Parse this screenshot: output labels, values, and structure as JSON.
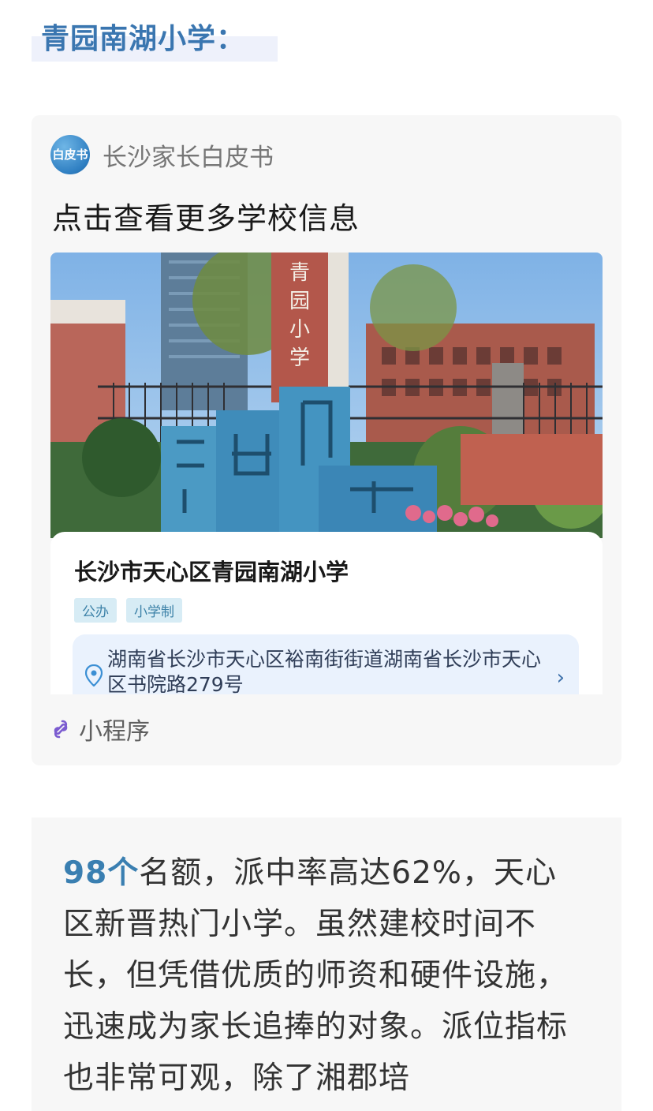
{
  "heading": {
    "title": "青园南湖小学："
  },
  "card": {
    "source_icon_text": "白皮书",
    "source_name": "长沙家长白皮书",
    "headline": "点击查看更多学校信息",
    "school": {
      "name": "长沙市天心区青园南湖小学",
      "tags": [
        "公办",
        "小学制"
      ],
      "address": "湖南省长沙市天心区裕南街街道湖南省长沙市天心区书院路279号"
    },
    "photo_sign_text": "青园小学",
    "mini_program_label": "小程序"
  },
  "article": {
    "highlight": "98个",
    "text": "名额，派中率高达62%，天心区新晋热门小学。虽然建校时间不长，但凭借优质的师资和硬件设施，迅速成为家长追捧的对象。派位指标也非常可观，除了湘郡培"
  },
  "colors": {
    "accent": "#3a76b0",
    "tag_bg": "#d7ecf5",
    "address_bg": "#eaf2fd",
    "card_bg": "#f7f7f7"
  },
  "icons": [
    "source-logo-icon",
    "location-pin-icon",
    "chevron-right-icon",
    "mini-program-link-icon"
  ]
}
